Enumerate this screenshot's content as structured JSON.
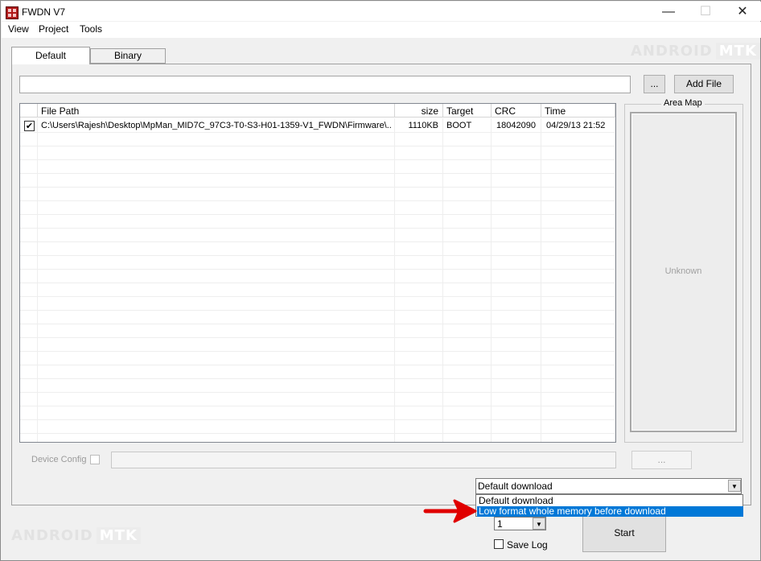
{
  "window": {
    "title": "FWDN V7",
    "minimize": "—",
    "maximize": "☐",
    "close": "✕"
  },
  "menu": [
    "View",
    "Project",
    "Tools"
  ],
  "tabs": [
    "Default",
    "Binary"
  ],
  "file_input": {
    "value": ""
  },
  "buttons": {
    "browse": "...",
    "add_file": "Add File",
    "device_config_browse": "...",
    "start": "Start"
  },
  "table": {
    "columns": [
      "File Path",
      "size",
      "Target",
      "CRC",
      "Time"
    ],
    "rows": [
      {
        "checked": true,
        "file_path": "C:\\Users\\Rajesh\\Desktop\\MpMan_MID7C_97C3-T0-S3-H01-1359-V1_FWDN\\Firmware\\...",
        "size": "1110KB",
        "target": "BOOT",
        "crc": "18042090",
        "time": "04/29/13 21:52"
      }
    ]
  },
  "area_map": {
    "label": "Area Map",
    "status": "Unknown"
  },
  "device_config": {
    "label": "Device Config",
    "checked": false
  },
  "download_mode": {
    "selected": "Default download",
    "options": [
      "Default download",
      "Low format whole memory before download"
    ],
    "highlighted": "Low format whole memory before download"
  },
  "count_select": {
    "value": "1"
  },
  "save_log": {
    "label": "Save Log",
    "checked": false
  },
  "watermark": {
    "brand": "ANDROID",
    "suffix": "MTK"
  },
  "colors": {
    "selection": "#0078d7",
    "arrow": "#e00000"
  }
}
